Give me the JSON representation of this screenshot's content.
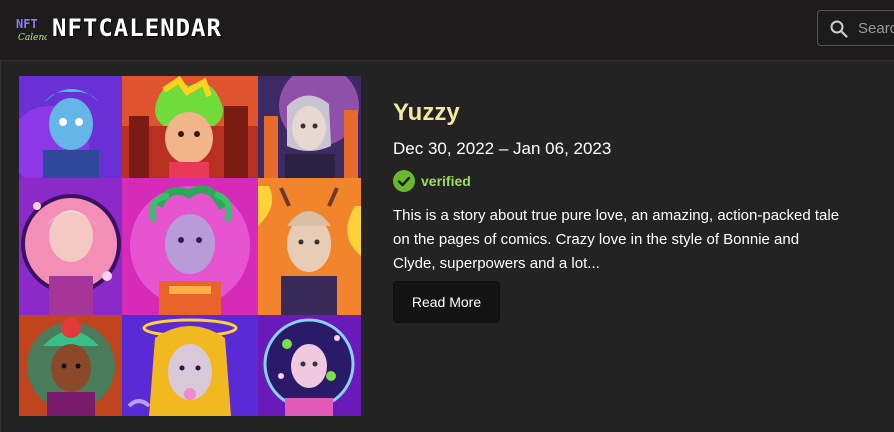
{
  "header": {
    "brand": "NFTCALENDAR",
    "logo_badge_text": "NFT Calendar",
    "search": {
      "placeholder": "Search",
      "value": ""
    }
  },
  "card": {
    "title": "Yuzzy",
    "dates": "Dec 30, 2022 – Jan 06, 2023",
    "verified_label": "verified",
    "description": "This is a story about true pure love, an amazing, action-packed tale on the pages of comics. Crazy love in the style of Bonnie and Clyde, superpowers and a lot...",
    "read_more_label": "Read More",
    "artwork": {
      "rows": 3,
      "cols": 3
    }
  },
  "colors": {
    "page_bg": "#1c1c1c",
    "card_bg": "#232323",
    "title": "#f6e7a1",
    "verified_badge": "#6ab82e",
    "verified_text": "#9be05a",
    "button_bg": "#141414"
  },
  "icons": {
    "search": "search-icon",
    "verified": "check-circle-icon",
    "logo": "nft-calendar-logo"
  }
}
